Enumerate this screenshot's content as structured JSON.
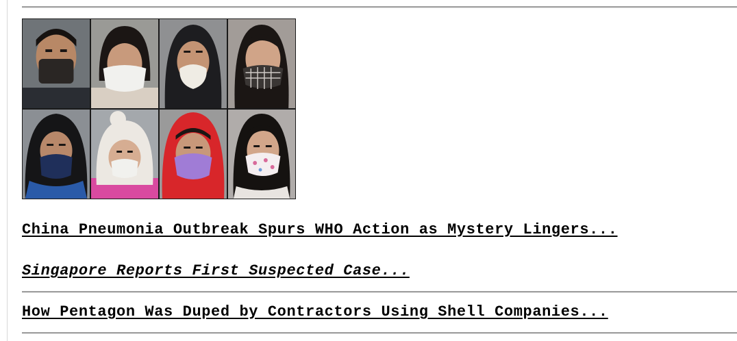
{
  "headlines": {
    "main": "China Pneumonia Outbreak Spurs WHO Action as Mystery Lingers...",
    "sub": "Singapore Reports First Suspected Case...",
    "next": "How Pentagon Was Duped by Contractors Using Shell Companies..."
  },
  "photo": {
    "icon": "masked-faces-photo",
    "colors": {
      "frame": "#1a1a1a",
      "skin": "#c89a7c",
      "hair": "#1b1614",
      "mask_black": "#2a2624",
      "mask_white": "#f1f1ee",
      "mask_purple": "#a07cd6",
      "hood_red": "#d8262a",
      "hat_white": "#ece8e2",
      "jacket_pink": "#d94aa0"
    }
  }
}
